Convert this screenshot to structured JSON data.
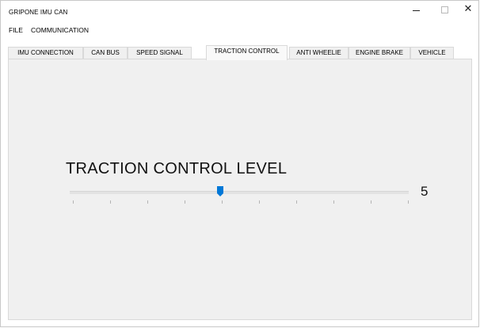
{
  "window": {
    "title": "GRIPONE IMU CAN",
    "controls": {
      "minimize": "minimize",
      "maximize": "maximize",
      "close": "✕"
    }
  },
  "menubar": {
    "items": [
      "FILE",
      "COMMUNICATION"
    ]
  },
  "tabs": [
    {
      "label": "IMU CONNECTION",
      "active": false
    },
    {
      "label": "CAN BUS",
      "active": false
    },
    {
      "label": "SPEED SIGNAL",
      "active": false
    },
    {
      "label": "TRACTION CONTROL",
      "active": true
    },
    {
      "label": "ANTI WHEELIE",
      "active": false
    },
    {
      "label": "ENGINE BRAKE",
      "active": false
    },
    {
      "label": "VEHICLE",
      "active": false
    }
  ],
  "traction_control": {
    "heading": "TRACTION CONTROL LEVEL",
    "level": 5,
    "level_text": "5",
    "slider": {
      "min": 1,
      "max": 10,
      "value": 5,
      "accent": "#0078d7"
    }
  },
  "colors": {
    "panel": "#f0f0f0",
    "accent": "#0078d7"
  }
}
